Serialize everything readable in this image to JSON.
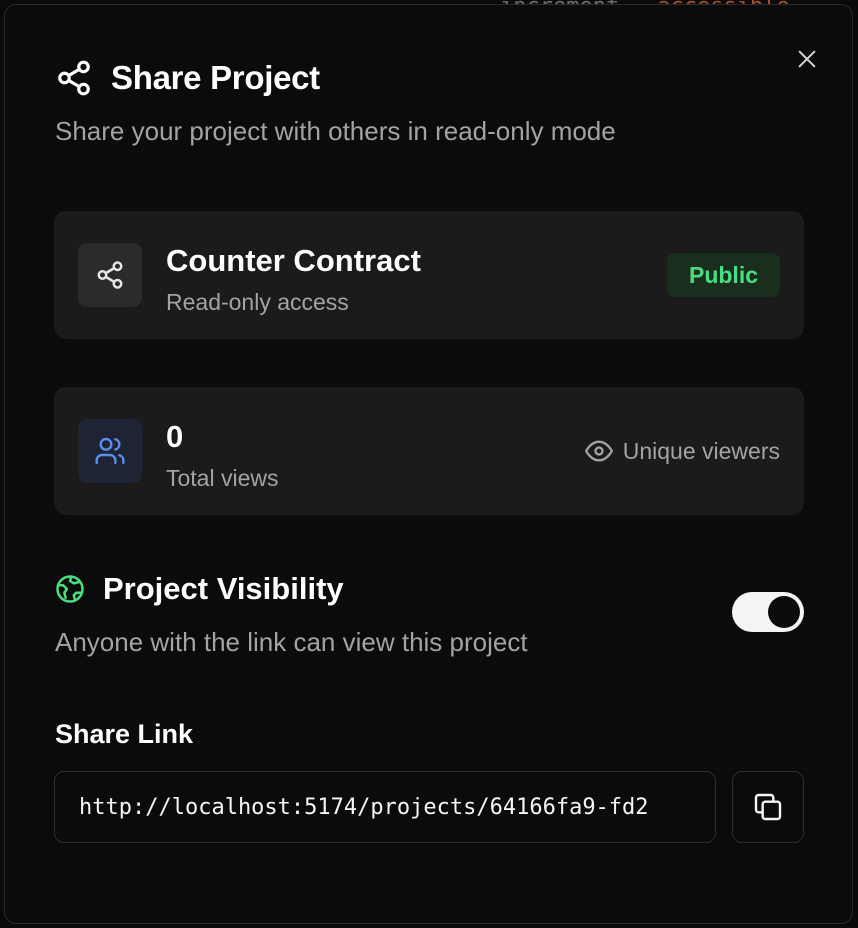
{
  "backdrop": {
    "code_left": "increment",
    "code_right": "accessible"
  },
  "dialog": {
    "title": "Share Project",
    "subtitle": "Share your project with others in read-only mode"
  },
  "project_card": {
    "name": "Counter Contract",
    "access": "Read-only access",
    "badge": "Public"
  },
  "views_card": {
    "count": "0",
    "label": "Total views",
    "unique_label": "Unique viewers"
  },
  "visibility": {
    "title": "Project Visibility",
    "description": "Anyone with the link can view this project",
    "enabled": true
  },
  "share_link": {
    "label": "Share Link",
    "value": "http://localhost:5174/projects/64166fa9-fd2"
  },
  "colors": {
    "accent_green": "#4ade80",
    "accent_blue": "#5b8def",
    "card_bg": "#1b1b1b",
    "modal_bg": "#0b0b0b"
  },
  "icons": {
    "title": "share-icon",
    "project": "share-icon",
    "views": "users-icon",
    "unique": "eye-icon",
    "visibility": "globe-icon",
    "close": "close-icon",
    "copy": "copy-icon"
  }
}
